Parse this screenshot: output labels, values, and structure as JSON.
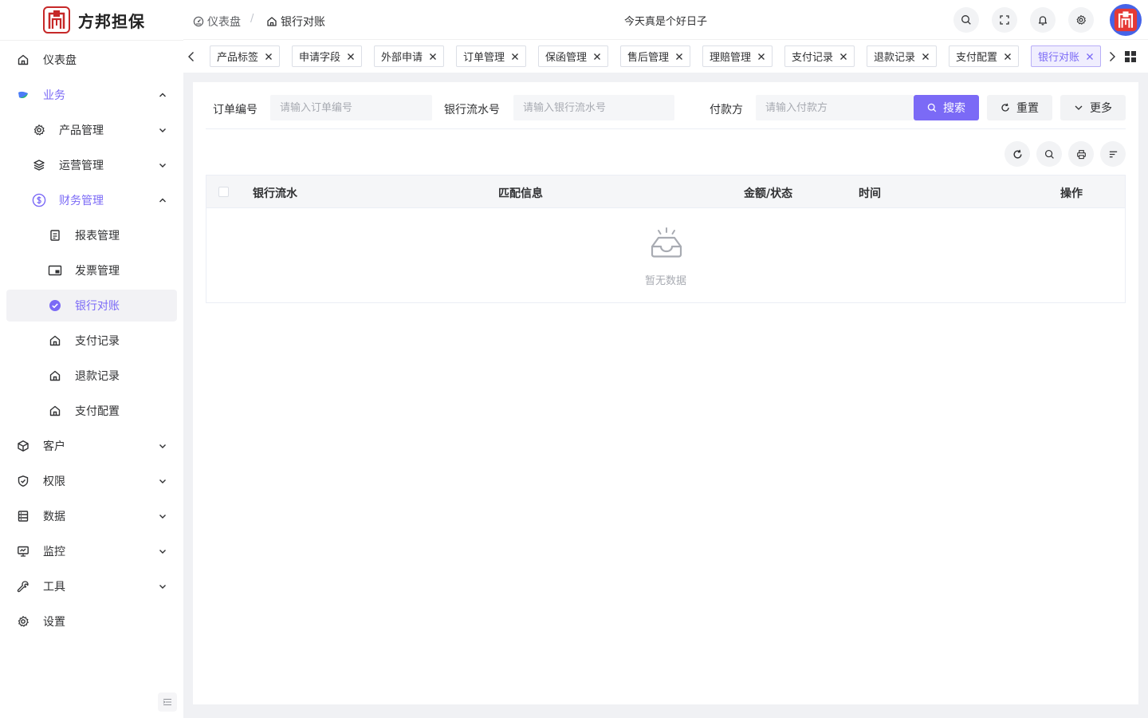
{
  "app": {
    "name": "方邦担保",
    "brand_color": "#7b6af6",
    "logo_color": "#c62828"
  },
  "header": {
    "breadcrumb": [
      {
        "label": "仪表盘",
        "icon": "dashboard-icon"
      },
      {
        "label": "银行对账",
        "icon": "home-icon"
      }
    ],
    "breadcrumb_separator": "/",
    "motto": "今天真是个好日子",
    "actions": [
      "search-icon",
      "fullscreen-icon",
      "bell-icon",
      "gear-icon"
    ]
  },
  "sidebar": {
    "items": [
      {
        "label": "仪表盘",
        "icon": "home-icon"
      },
      {
        "label": "业务",
        "icon": "business-icon",
        "expanded": true
      },
      {
        "label": "产品管理",
        "icon": "gear-icon"
      },
      {
        "label": "运营管理",
        "icon": "layers-icon"
      },
      {
        "label": "财务管理",
        "icon": "dollar-icon",
        "expanded": true
      },
      {
        "label": "报表管理",
        "icon": "document-icon"
      },
      {
        "label": "发票管理",
        "icon": "invoice-icon"
      },
      {
        "label": "银行对账",
        "icon": "check-circle-icon",
        "active": true
      },
      {
        "label": "支付记录",
        "icon": "home-icon"
      },
      {
        "label": "退款记录",
        "icon": "home-icon"
      },
      {
        "label": "支付配置",
        "icon": "home-icon"
      },
      {
        "label": "客户",
        "icon": "box-icon"
      },
      {
        "label": "权限",
        "icon": "shield-icon"
      },
      {
        "label": "数据",
        "icon": "database-icon"
      },
      {
        "label": "监控",
        "icon": "monitor-icon"
      },
      {
        "label": "工具",
        "icon": "wrench-icon"
      },
      {
        "label": "设置",
        "icon": "gear-icon"
      }
    ]
  },
  "tabs": [
    {
      "label": "产品标签"
    },
    {
      "label": "申请字段"
    },
    {
      "label": "外部申请"
    },
    {
      "label": "订单管理"
    },
    {
      "label": "保函管理"
    },
    {
      "label": "售后管理"
    },
    {
      "label": "理赔管理"
    },
    {
      "label": "支付记录"
    },
    {
      "label": "退款记录"
    },
    {
      "label": "支付配置"
    },
    {
      "label": "银行对账",
      "active": true
    }
  ],
  "filters": {
    "order_no": {
      "label": "订单编号",
      "placeholder": "请输入订单编号",
      "value": ""
    },
    "bank_serial": {
      "label": "银行流水号",
      "placeholder": "请输入银行流水号",
      "value": ""
    },
    "payer": {
      "label": "付款方",
      "placeholder": "请输入付款方",
      "value": ""
    },
    "search_label": "搜索",
    "reset_label": "重置",
    "more_label": "更多"
  },
  "toolbar": [
    "refresh-icon",
    "search-icon",
    "print-icon",
    "column-settings-icon"
  ],
  "table": {
    "columns": [
      "银行流水",
      "匹配信息",
      "金额/状态",
      "时间",
      "操作"
    ],
    "rows": [],
    "empty_text": "暂无数据"
  }
}
